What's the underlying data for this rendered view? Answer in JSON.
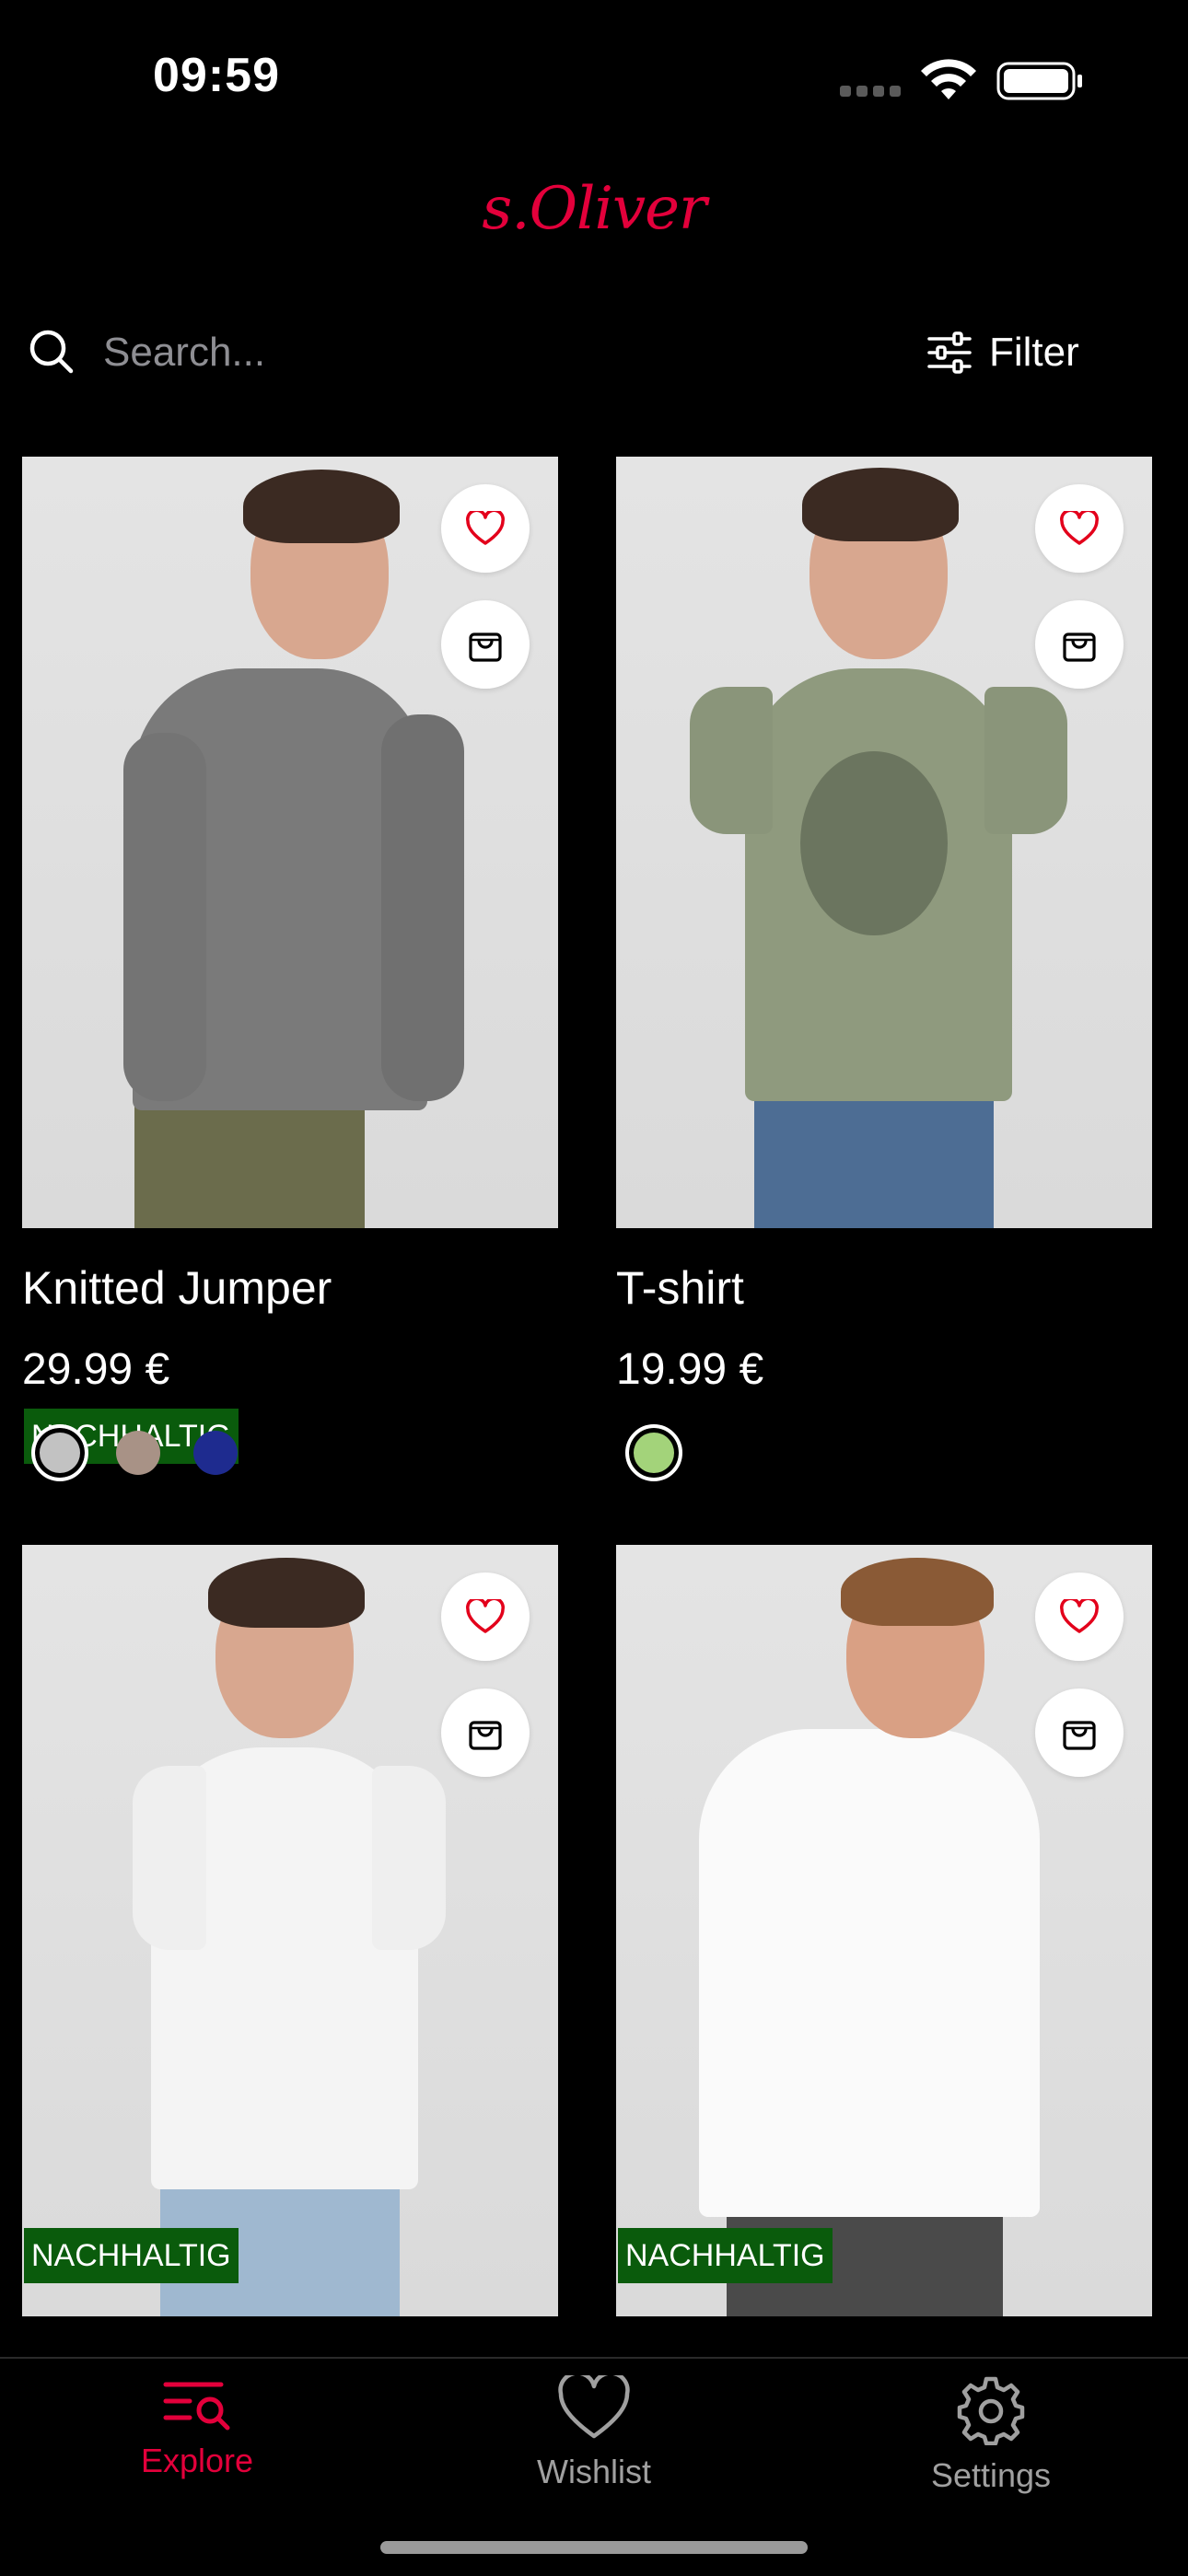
{
  "status_bar": {
    "time": "09:59"
  },
  "brand": {
    "logo_text": "s.Oliver",
    "accent_color": "#e3003b"
  },
  "search": {
    "placeholder": "Search..."
  },
  "filter": {
    "label": "Filter",
    "icon": "sliders-icon"
  },
  "products": [
    {
      "name": "Knitted Jumper",
      "price": "29.99 €",
      "badge": "NACHHALTIG",
      "swatches": [
        "#c2c2c2",
        "#a89286",
        "#1e2b8f"
      ],
      "selected_swatch": 0
    },
    {
      "name": "T-shirt",
      "price": "19.99 €",
      "badge": "",
      "swatches": [
        "#a3d37a"
      ],
      "selected_swatch": 0
    },
    {
      "name": "",
      "price": "",
      "badge": "NACHHALTIG",
      "swatches": [],
      "selected_swatch": null
    },
    {
      "name": "",
      "price": "",
      "badge": "NACHHALTIG",
      "swatches": [],
      "selected_swatch": null
    }
  ],
  "tabbar": {
    "active_color": "#e3003b",
    "inactive_color": "#a0a0a0",
    "tabs": [
      {
        "label": "Explore",
        "icon": "explore-search-icon",
        "active": true
      },
      {
        "label": "Wishlist",
        "icon": "heart-icon",
        "active": false
      },
      {
        "label": "Settings",
        "icon": "gear-icon",
        "active": false
      }
    ]
  }
}
